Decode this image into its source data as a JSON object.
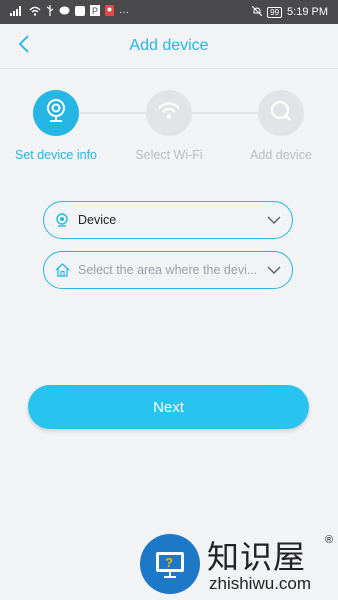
{
  "status_bar": {
    "left_icons": [
      "4G signal",
      "wifi",
      "usb",
      "message",
      "notification",
      "parking",
      "location"
    ],
    "more": "···",
    "battery": "99",
    "time": "5:19 PM"
  },
  "header": {
    "title": "Add device",
    "back_icon": "chevron-left-icon"
  },
  "steps": [
    {
      "label": "Set device info",
      "icon": "camera-icon",
      "active": true
    },
    {
      "label": "Select Wi-Fi",
      "icon": "wifi-icon",
      "active": false
    },
    {
      "label": "Add device",
      "icon": "search-icon",
      "active": false
    }
  ],
  "form": {
    "device_value": "Device",
    "area_placeholder": "Select the area where the devi..."
  },
  "next_label": "Next",
  "watermark": {
    "cn": "知识屋",
    "reg": "®",
    "en": "zhishiwu.com"
  },
  "colors": {
    "accent": "#25b6e6",
    "button": "#29c3ef",
    "inactive_step": "#e2e3e6",
    "inactive_text": "#b8bcc2"
  }
}
